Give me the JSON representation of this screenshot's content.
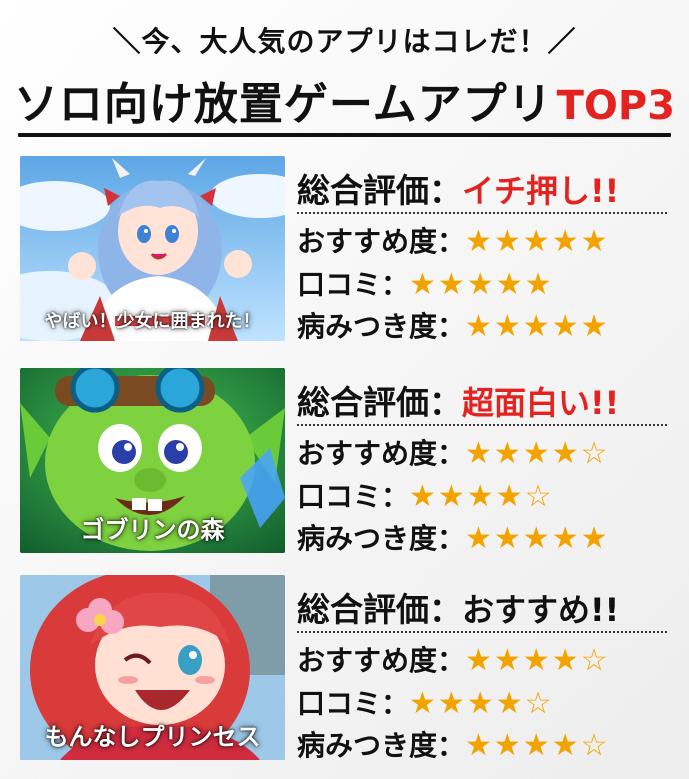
{
  "header": {
    "subtitle": "＼今、大人気のアプリはコレだ！／",
    "title_main": "ソロ向け放置ゲームアプリ",
    "title_accent": "TOP3"
  },
  "labels": {
    "overall": "総合評価：",
    "recommend": "おすすめ度：",
    "reviews": "口コミ：",
    "addiction": "病みつき度："
  },
  "entries": [
    {
      "title": "やばい！少女に囲まれた！",
      "overall": "イチ押し!!",
      "overall_color": "#e3231f",
      "recommend_stars": "★★★★★",
      "reviews_stars": "★★★★★",
      "addiction_stars": "★★★★★"
    },
    {
      "title": "ゴブリンの森",
      "overall": "超面白い!!",
      "overall_color": "#e3231f",
      "recommend_stars": "★★★★☆",
      "reviews_stars": "★★★★☆",
      "addiction_stars": "★★★★★"
    },
    {
      "title": "もんなしプリンセス",
      "overall": "おすすめ!!",
      "overall_color": "#111111",
      "recommend_stars": "★★★★☆",
      "reviews_stars": "★★★★☆",
      "addiction_stars": "★★★★☆"
    }
  ],
  "colors": {
    "accent": "#e3231f",
    "star": "#f3a300",
    "text": "#111111"
  }
}
